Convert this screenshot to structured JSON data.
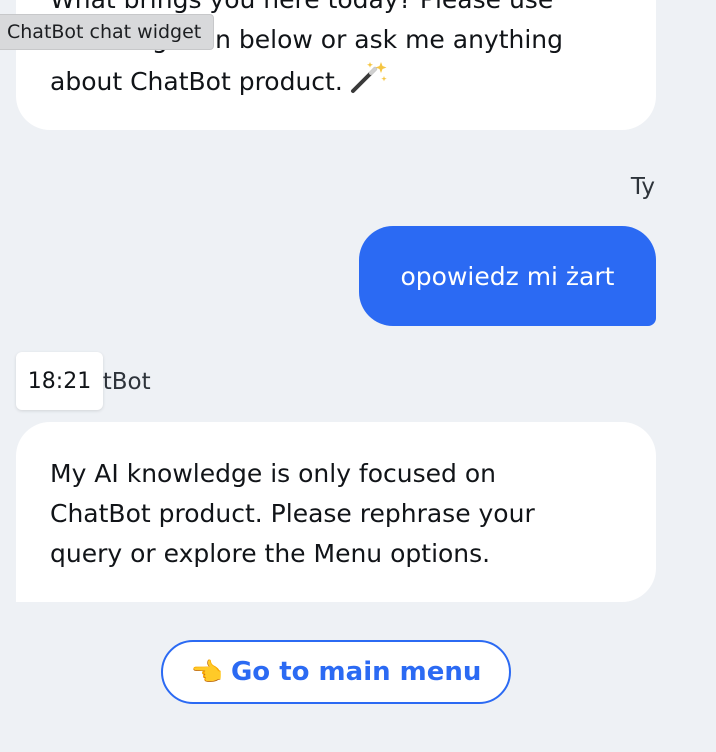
{
  "widget_tooltip": {
    "label": "ChatBot chat widget"
  },
  "messages": {
    "first_bot": {
      "lines": [
        "What brings you here today? Please use",
        "the navigation below or ask me anything",
        "about ChatBot product."
      ],
      "trailing_icon": "magic-wand-icon"
    },
    "user": {
      "sender": "Ty",
      "text": "opowiedz mi żart"
    },
    "second_bot": {
      "sender": "ChatBot",
      "timestamp": "18:21",
      "lines": [
        "My AI knowledge is only focused on",
        "ChatBot product. Please rephrase your",
        "query or explore the Menu options."
      ]
    }
  },
  "menu_button": {
    "icon": "pointing-hand-icon",
    "label": "Go to main menu"
  },
  "colors": {
    "accent": "#2b6af3",
    "background": "#eef1f5",
    "bubble": "#ffffff"
  }
}
